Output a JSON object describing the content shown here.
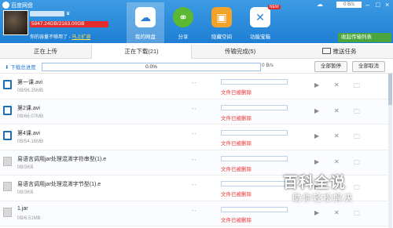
{
  "app": {
    "title": "百度网盘"
  },
  "user": {
    "quota_text": "5947.24GB/2163.00GB",
    "quota_fraction": 1.0,
    "capacity_warning": "你的容量不够用了 -",
    "upgrade_link": "马上扩容"
  },
  "nav": [
    {
      "label": "我的网盘",
      "icon": "cloud-drive-icon",
      "active": true
    },
    {
      "label": "分享",
      "icon": "share-icon",
      "active": false
    },
    {
      "label": "隐藏空间",
      "icon": "hidden-space-icon",
      "active": false
    },
    {
      "label": "功能宝箱",
      "icon": "toolbox-icon",
      "active": false,
      "badge": "NEW"
    }
  ],
  "topbar": {
    "speed": "0 B/s",
    "receive_button": "收起传输列表"
  },
  "tabs": [
    {
      "label": "正在上传",
      "active": false
    },
    {
      "label": "正在下载(21)",
      "active": true
    },
    {
      "label": "传输完成(5)",
      "active": false
    },
    {
      "label": "推送任务",
      "active": false
    }
  ],
  "toolbar": {
    "total_label": "下载总进度",
    "total_percent": "0.0%",
    "speed": "0 B/s",
    "pause_all": "全部暂停",
    "cancel_all": "全部取消"
  },
  "files": [
    {
      "name": "第一课.avi",
      "size": "0B/96.35MB",
      "type": "video",
      "dash": "--",
      "status": "文件已被删除"
    },
    {
      "name": "第2课.avi",
      "size": "0B/66.07MB",
      "type": "video",
      "dash": "--",
      "status": "文件已被删除"
    },
    {
      "name": "第4课.avi",
      "size": "0B/54.16MB",
      "type": "video",
      "dash": "--",
      "status": "文件已被删除"
    },
    {
      "name": "易语言调用jar处理混淆字符串型(1).e",
      "size": "0B/3KB",
      "type": "doc",
      "dash": "--",
      "status": "文件已被删除"
    },
    {
      "name": "易语言调用jar处理混淆字节型(1).e",
      "size": "0B/3KB",
      "type": "doc",
      "dash": "--",
      "status": "文件已被删除"
    },
    {
      "name": "1.jar",
      "size": "0B/6.51MB",
      "type": "doc",
      "dash": "--",
      "status": "文件已被删除"
    }
  ],
  "watermark": {
    "main": "百科全说",
    "sub": "助你轻松解决"
  }
}
